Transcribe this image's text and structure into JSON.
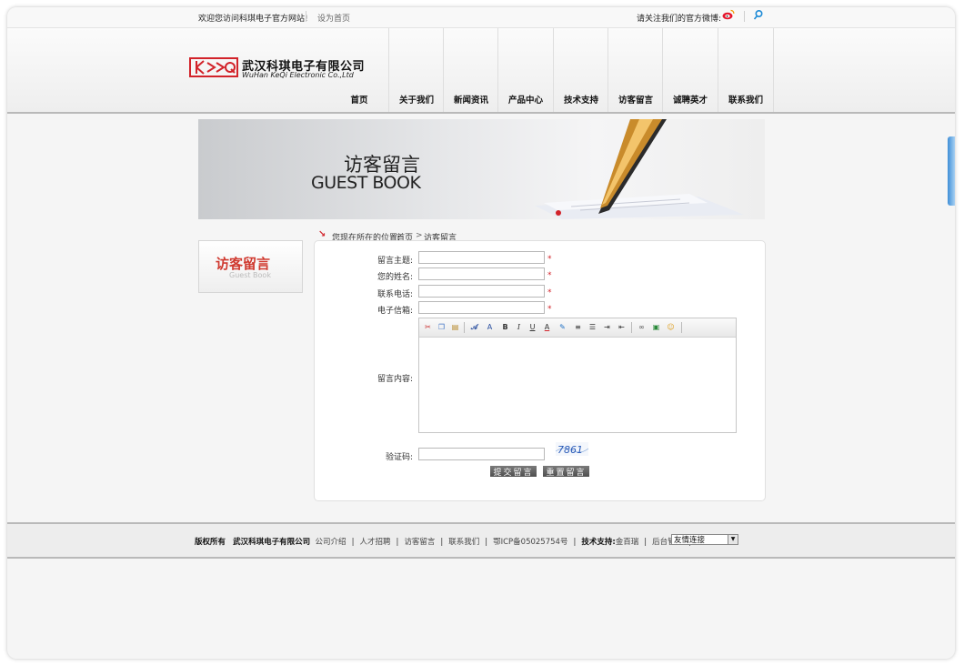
{
  "topbar": {
    "welcome": "欢迎您访问科琪电子官方网站!",
    "set_home": "设为首页",
    "follow": "请关注我们的官方微博:"
  },
  "logo": {
    "cn": "武汉科琪电子有限公司",
    "en": "WuHan KeQi Electronic Co.,Ltd"
  },
  "nav": [
    "首页",
    "关于我们",
    "新闻资讯",
    "产品中心",
    "技术支持",
    "访客留言",
    "诚聘英才",
    "联系我们"
  ],
  "banner": {
    "title_cn": "访客留言",
    "title_en": "GUEST BOOK"
  },
  "sidebar": {
    "title_cn": "访客留言",
    "title_en": "Guest Book"
  },
  "breadcrumb": {
    "label": "您现在所在的位置:",
    "home": "首页",
    "sep": ">",
    "current": "访客留言"
  },
  "form": {
    "subject_label": "留言主题:",
    "name_label": "您的姓名:",
    "phone_label": "联系电话:",
    "email_label": "电子信箱:",
    "content_label": "留言内容:",
    "captcha_label": "验证码:",
    "captcha_code": "7861",
    "required_mark": "*",
    "submit": "提交留言",
    "reset": "重置留言"
  },
  "footer": {
    "copyright": "版权所有",
    "company": "武汉科琪电子有限公司",
    "links": [
      "公司介绍",
      "人才招聘",
      "访客留言",
      "联系我们",
      "鄂ICP备05025754号"
    ],
    "tech_label": "技术支持:",
    "tech_name": "金百瑞",
    "admin": "后台管理",
    "friend_links": "友情连接"
  },
  "colors": {
    "accent": "#d2232a",
    "button": "#5f5f5f"
  },
  "icons": [
    "weibo-icon",
    "tencent-weibo-icon",
    "cut-icon",
    "copy-icon",
    "paste-icon",
    "font-icon",
    "bold-icon",
    "italic-icon",
    "underline-icon",
    "font-color-icon",
    "bg-color-icon",
    "align-icon",
    "list-icon",
    "indent-icon",
    "outdent-icon",
    "link-icon",
    "image-icon",
    "emoticon-icon"
  ]
}
